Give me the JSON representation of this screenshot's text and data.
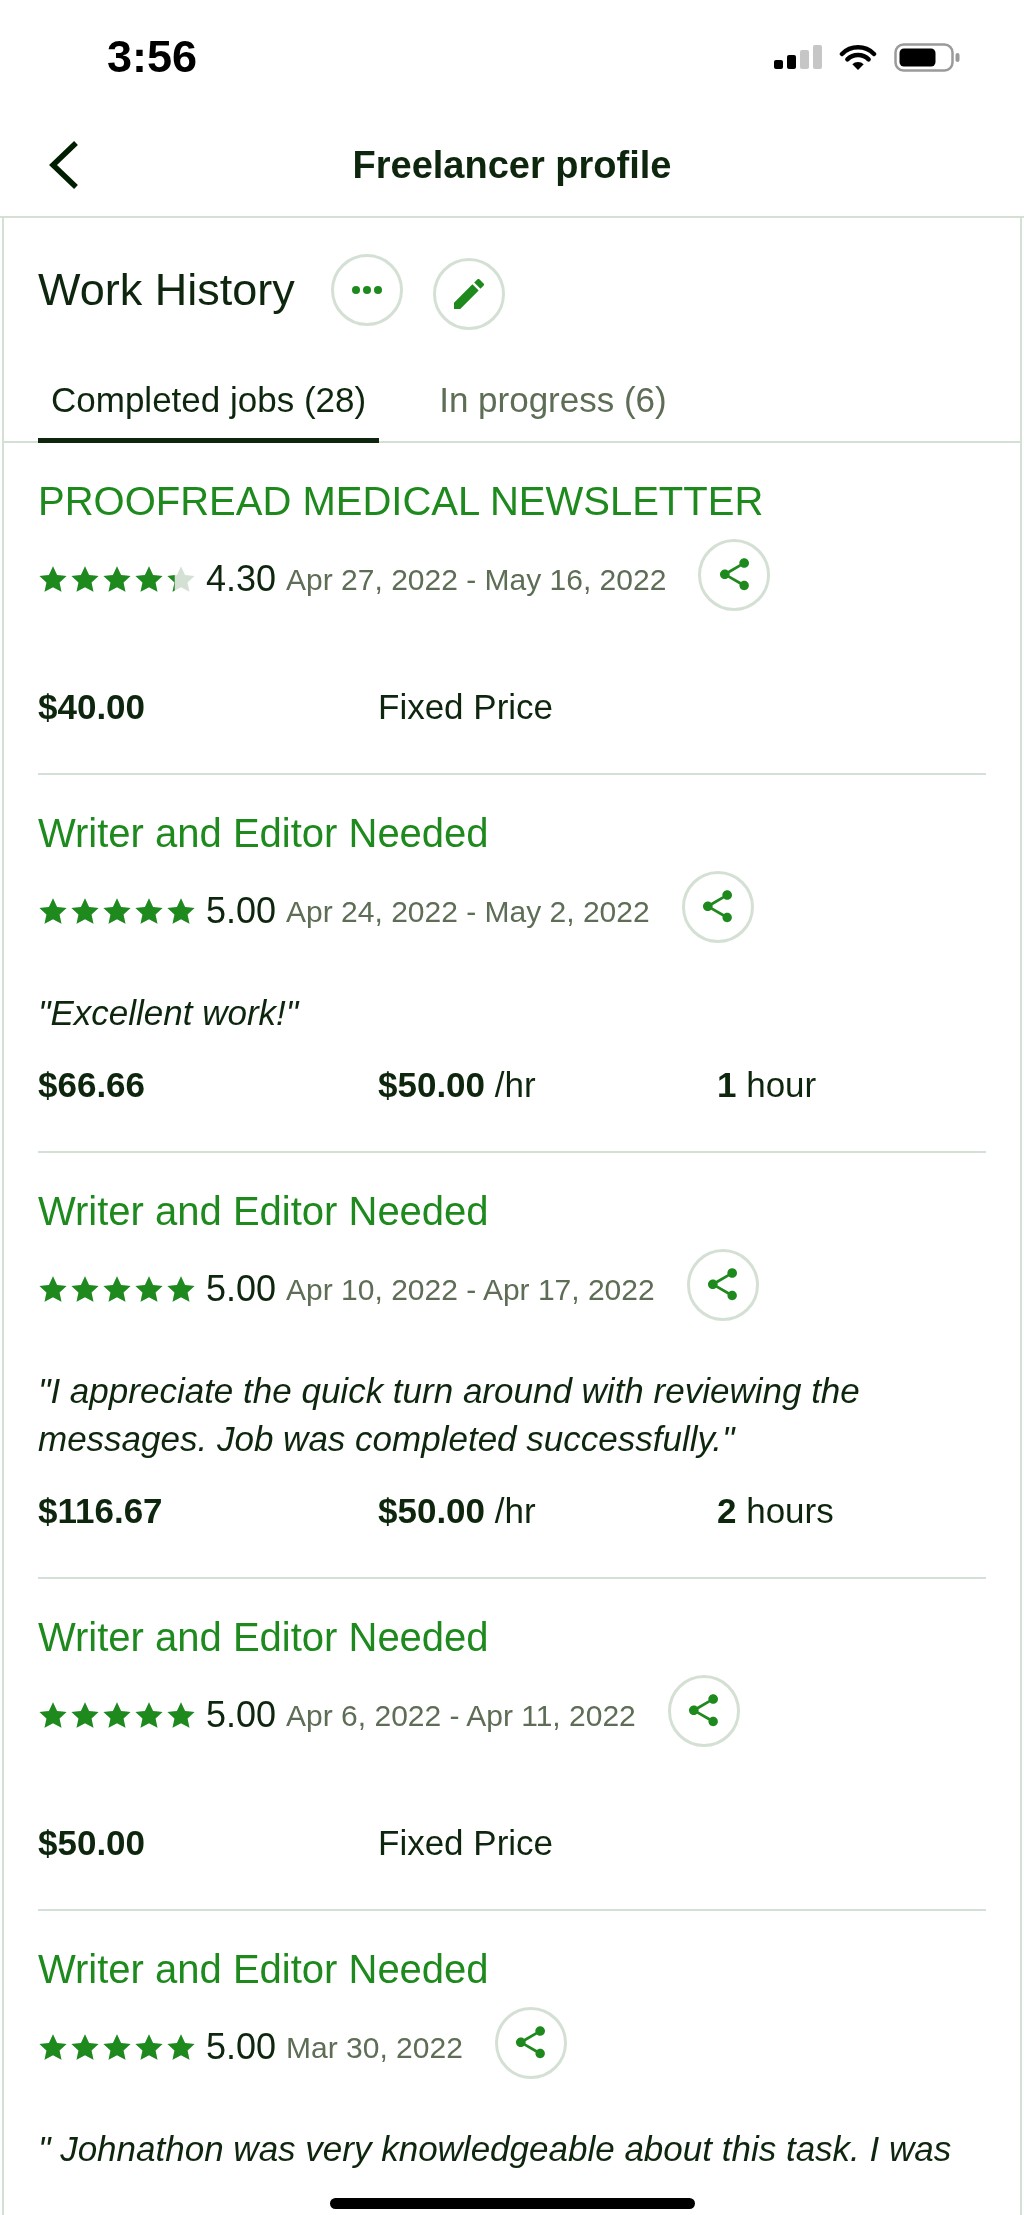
{
  "status_bar": {
    "time": "3:56"
  },
  "header": {
    "title": "Freelancer profile"
  },
  "section": {
    "title": "Work History"
  },
  "tabs": [
    {
      "label": "Completed jobs (28)",
      "selected": true
    },
    {
      "label": "In progress (6)",
      "selected": false
    }
  ],
  "jobs": [
    {
      "title": "PROOFREAD MEDICAL NEWSLETTER",
      "stars": 4.3,
      "rating": "4.30",
      "dates": "Apr 27, 2022 - May 16, 2022",
      "amount": "$40.00",
      "rate": "Fixed Price"
    },
    {
      "title": "Writer and Editor Needed",
      "stars": 5,
      "rating": "5.00",
      "dates": "Apr 24, 2022 - May 2, 2022",
      "quote": "\"Excellent work!\"",
      "amount": "$66.66",
      "rate": "**$50.00** /hr",
      "duration": "**1** hour"
    },
    {
      "title": "Writer and Editor Needed",
      "stars": 5,
      "rating": "5.00",
      "dates": "Apr 10, 2022 - Apr 17, 2022",
      "quote": "\"I appreciate the quick turn around with reviewing the messages. Job was completed successfully.\"",
      "amount": "$116.67",
      "rate": "**$50.00** /hr",
      "duration": "**2** hours"
    },
    {
      "title": "Writer and Editor Needed",
      "stars": 5,
      "rating": "5.00",
      "dates": "Apr 6, 2022 - Apr 11, 2022",
      "amount": "$50.00",
      "rate": "Fixed Price"
    },
    {
      "title": "Writer and Editor Needed",
      "stars": 5,
      "rating": "5.00",
      "dates": "Mar 30, 2022",
      "quote": "\" Johnathon was very knowledgeable about this task. I was"
    }
  ]
}
